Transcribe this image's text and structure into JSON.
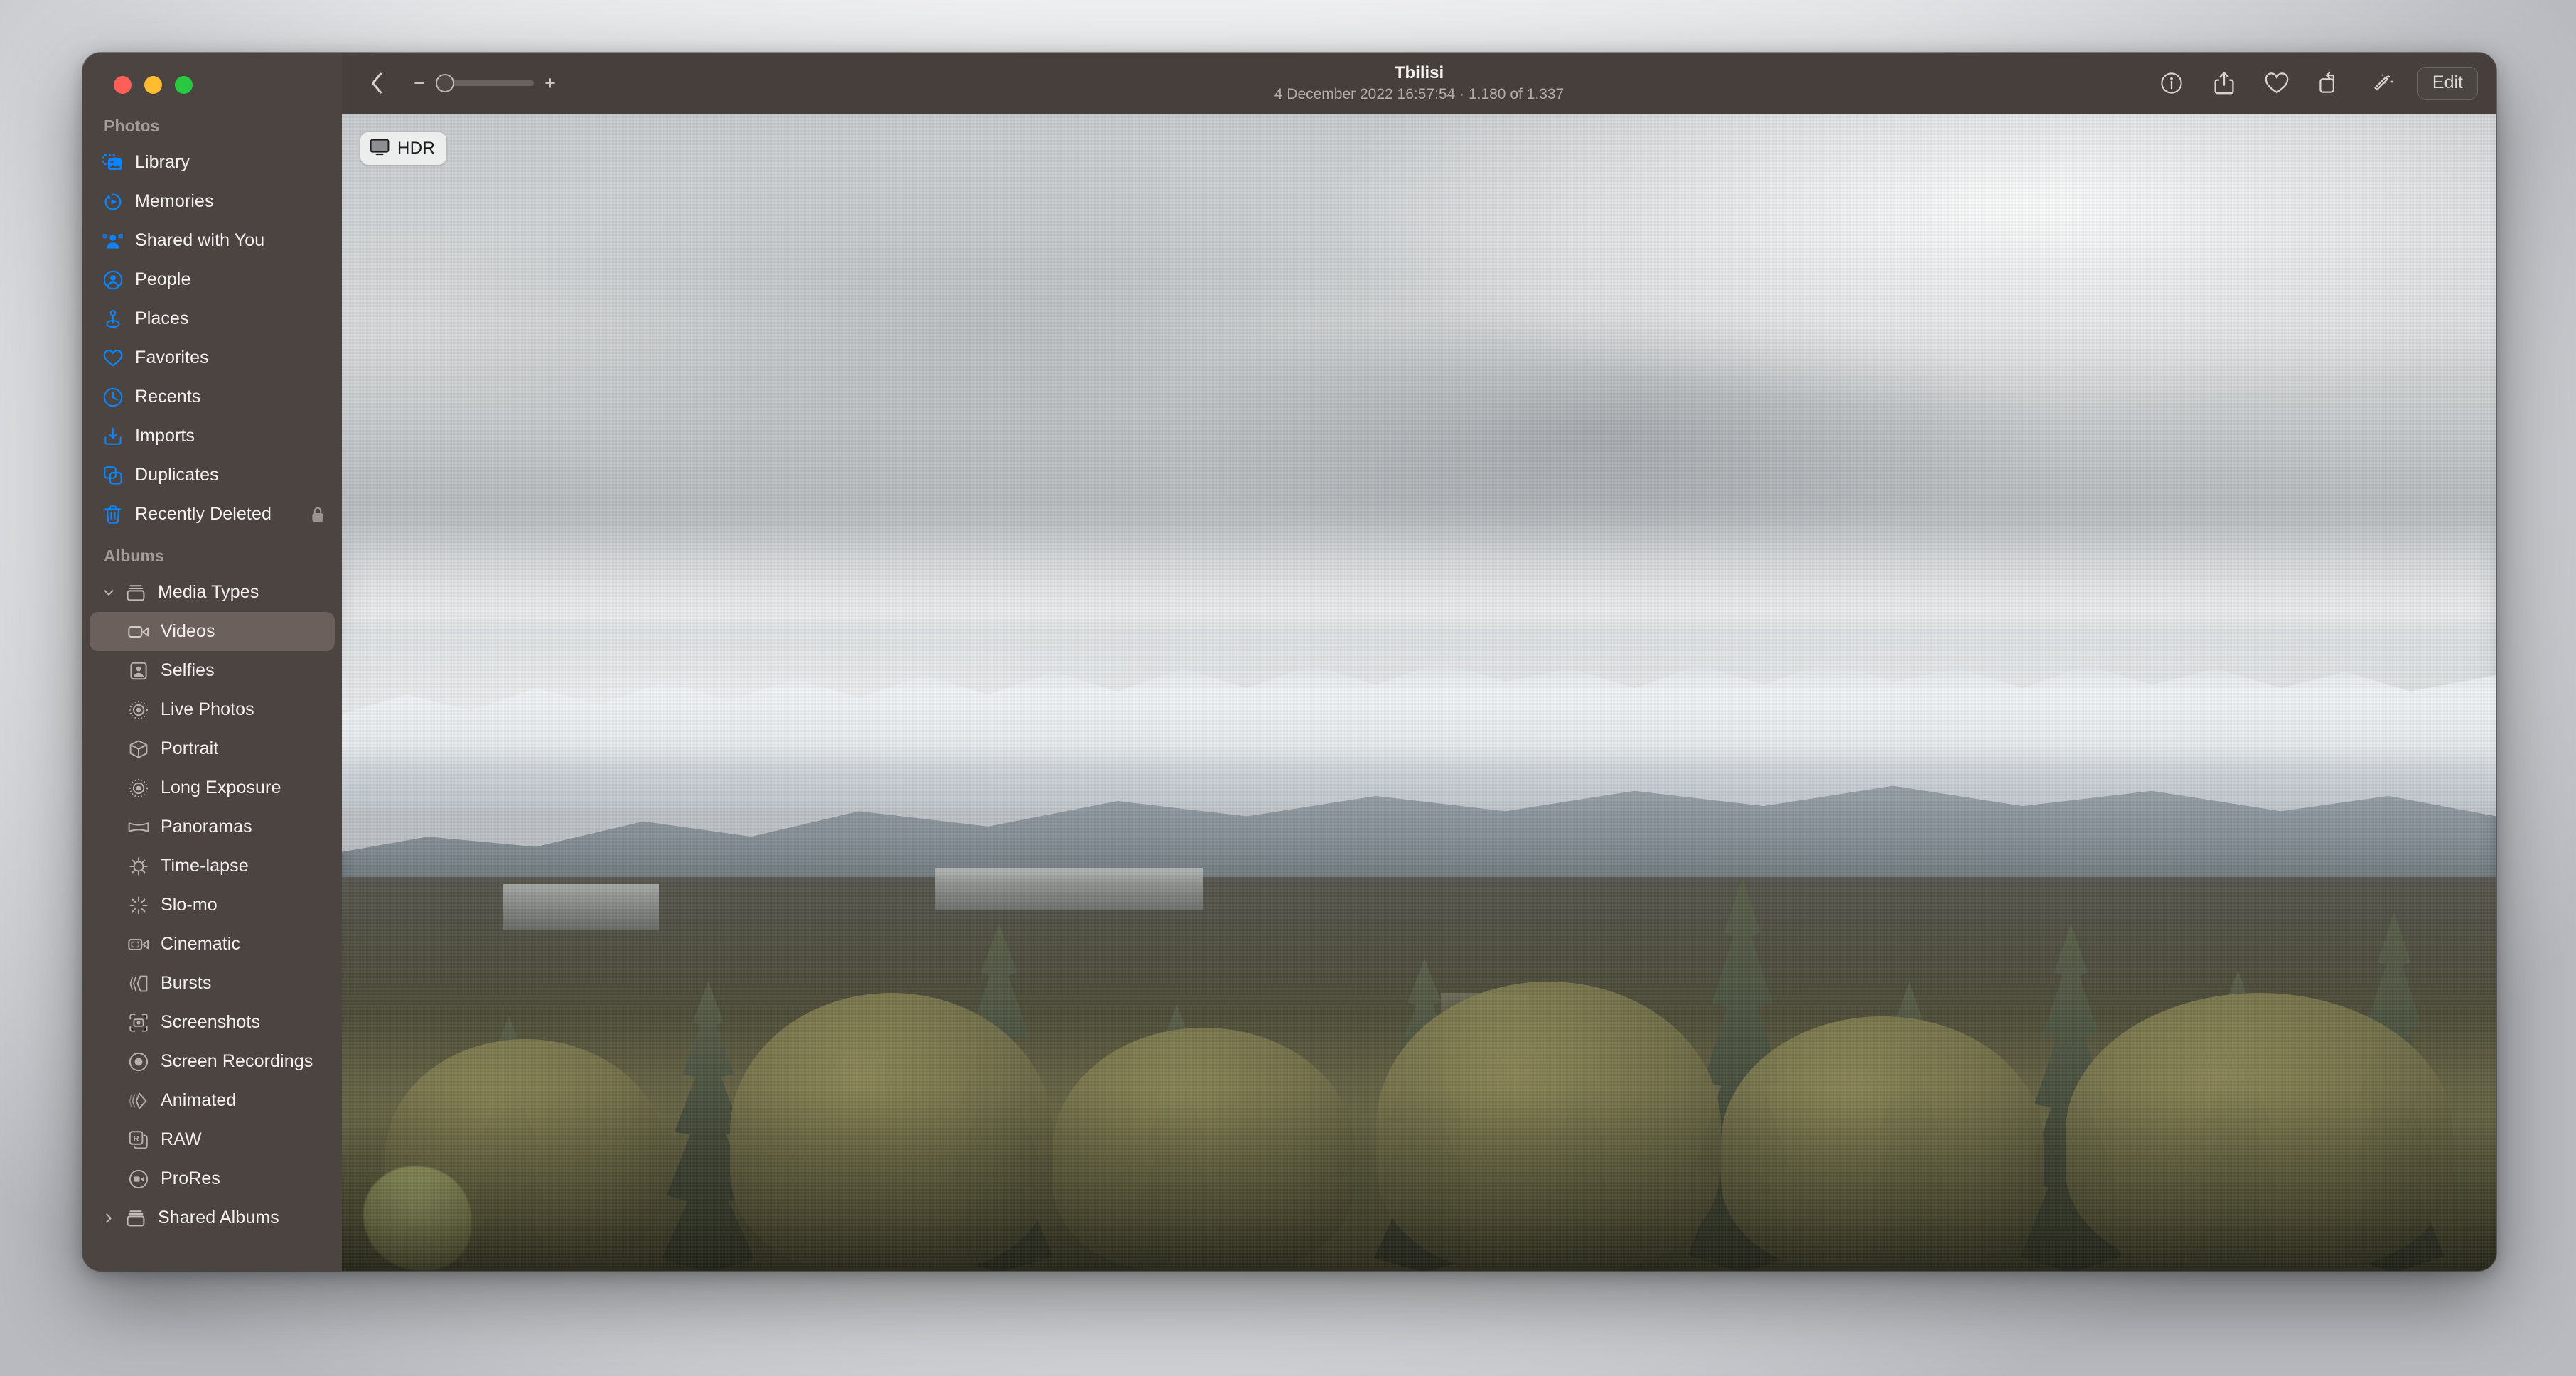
{
  "window": {
    "traffic_lights": [
      "close",
      "minimize",
      "zoom"
    ],
    "colors": {
      "close": "#ff5f57",
      "minimize": "#febc2e",
      "zoom": "#28c840",
      "accent": "#0a84ff",
      "chrome": "#463f3c",
      "sidebar": "#4c4441",
      "selection": "#6b605c"
    }
  },
  "sidebar": {
    "sections": [
      {
        "header": "Photos",
        "items": [
          {
            "label": "Library",
            "icon": "library-icon",
            "tint": "blue"
          },
          {
            "label": "Memories",
            "icon": "memories-icon",
            "tint": "blue"
          },
          {
            "label": "Shared with You",
            "icon": "shared-with-you-icon",
            "tint": "blue"
          },
          {
            "label": "People",
            "icon": "people-icon",
            "tint": "blue"
          },
          {
            "label": "Places",
            "icon": "places-pin-icon",
            "tint": "blue"
          },
          {
            "label": "Favorites",
            "icon": "heart-icon",
            "tint": "blue"
          },
          {
            "label": "Recents",
            "icon": "clock-icon",
            "tint": "blue"
          },
          {
            "label": "Imports",
            "icon": "import-icon",
            "tint": "blue"
          },
          {
            "label": "Duplicates",
            "icon": "duplicates-icon",
            "tint": "blue"
          },
          {
            "label": "Recently Deleted",
            "icon": "trash-icon",
            "tint": "blue",
            "trailing_icon": "lock-icon"
          }
        ]
      },
      {
        "header": "Albums",
        "groups": [
          {
            "label": "Media Types",
            "icon": "album-stack-icon",
            "expanded": true,
            "items": [
              {
                "label": "Videos",
                "icon": "video-camera-icon",
                "selected": true
              },
              {
                "label": "Selfies",
                "icon": "selfie-person-icon"
              },
              {
                "label": "Live Photos",
                "icon": "live-photo-icon"
              },
              {
                "label": "Portrait",
                "icon": "portrait-cube-icon"
              },
              {
                "label": "Long Exposure",
                "icon": "long-exposure-icon"
              },
              {
                "label": "Panoramas",
                "icon": "panorama-icon"
              },
              {
                "label": "Time-lapse",
                "icon": "timelapse-icon"
              },
              {
                "label": "Slo-mo",
                "icon": "slomo-icon"
              },
              {
                "label": "Cinematic",
                "icon": "cinematic-icon"
              },
              {
                "label": "Bursts",
                "icon": "bursts-icon"
              },
              {
                "label": "Screenshots",
                "icon": "screenshot-icon"
              },
              {
                "label": "Screen Recordings",
                "icon": "screen-recording-icon"
              },
              {
                "label": "Animated",
                "icon": "animated-icon"
              },
              {
                "label": "RAW",
                "icon": "raw-icon"
              },
              {
                "label": "ProRes",
                "icon": "prores-icon"
              }
            ]
          },
          {
            "label": "Shared Albums",
            "icon": "album-stack-icon",
            "expanded": false,
            "items": []
          }
        ]
      }
    ]
  },
  "toolbar": {
    "back_icon": "chevron-left-icon",
    "zoom_out_label": "−",
    "zoom_in_label": "+",
    "zoom_value": 0,
    "title": "Tbilisi",
    "subtitle": "4 December 2022 16:57:54  ·  1.180 of 1.337",
    "date": "4 December 2022 16:57:54",
    "position": "1.180 of 1.337",
    "actions": [
      {
        "name": "info-button",
        "icon": "info-circle-icon"
      },
      {
        "name": "share-button",
        "icon": "share-icon"
      },
      {
        "name": "favorite-button",
        "icon": "heart-icon"
      },
      {
        "name": "rotate-button",
        "icon": "rotate-icon"
      },
      {
        "name": "auto-enhance-button",
        "icon": "magic-wand-icon"
      }
    ],
    "edit_label": "Edit"
  },
  "photo": {
    "badge": {
      "label": "HDR",
      "icon": "display-icon"
    },
    "alt": "Overcast view from a wooded ridge over Tbilisi toward snow-covered mountains"
  }
}
